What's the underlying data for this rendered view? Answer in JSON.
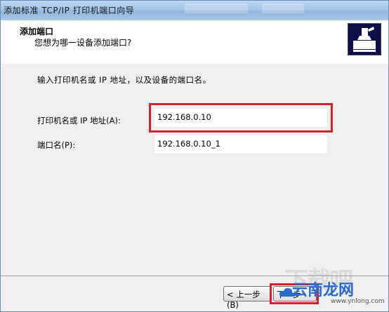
{
  "window": {
    "title": "添加标准 TCP/IP 打印机端口向导"
  },
  "header": {
    "title": "添加端口",
    "subtitle": "您想为哪一设备添加端口?"
  },
  "body": {
    "instruction": "输入打印机名或 IP 地址，以及设备的端口名。",
    "printer_name_label": "打印机名或 IP 地址(A):",
    "printer_name_value": "192.168.0.10",
    "port_name_label": "端口名(P):",
    "port_name_value": "192.168.0.10_1"
  },
  "footer": {
    "back_label": "< 上一步(B)",
    "next_label": "下一步"
  },
  "watermark": {
    "site": "云南龙网",
    "url": "www.ynlong.com",
    "corner_text": "下载吧"
  },
  "colors": {
    "highlight": "#d5222d",
    "titlebar": "#a6c4e6",
    "logo_bg": "#0c0f4a",
    "watermark": "#2a6bd2"
  }
}
